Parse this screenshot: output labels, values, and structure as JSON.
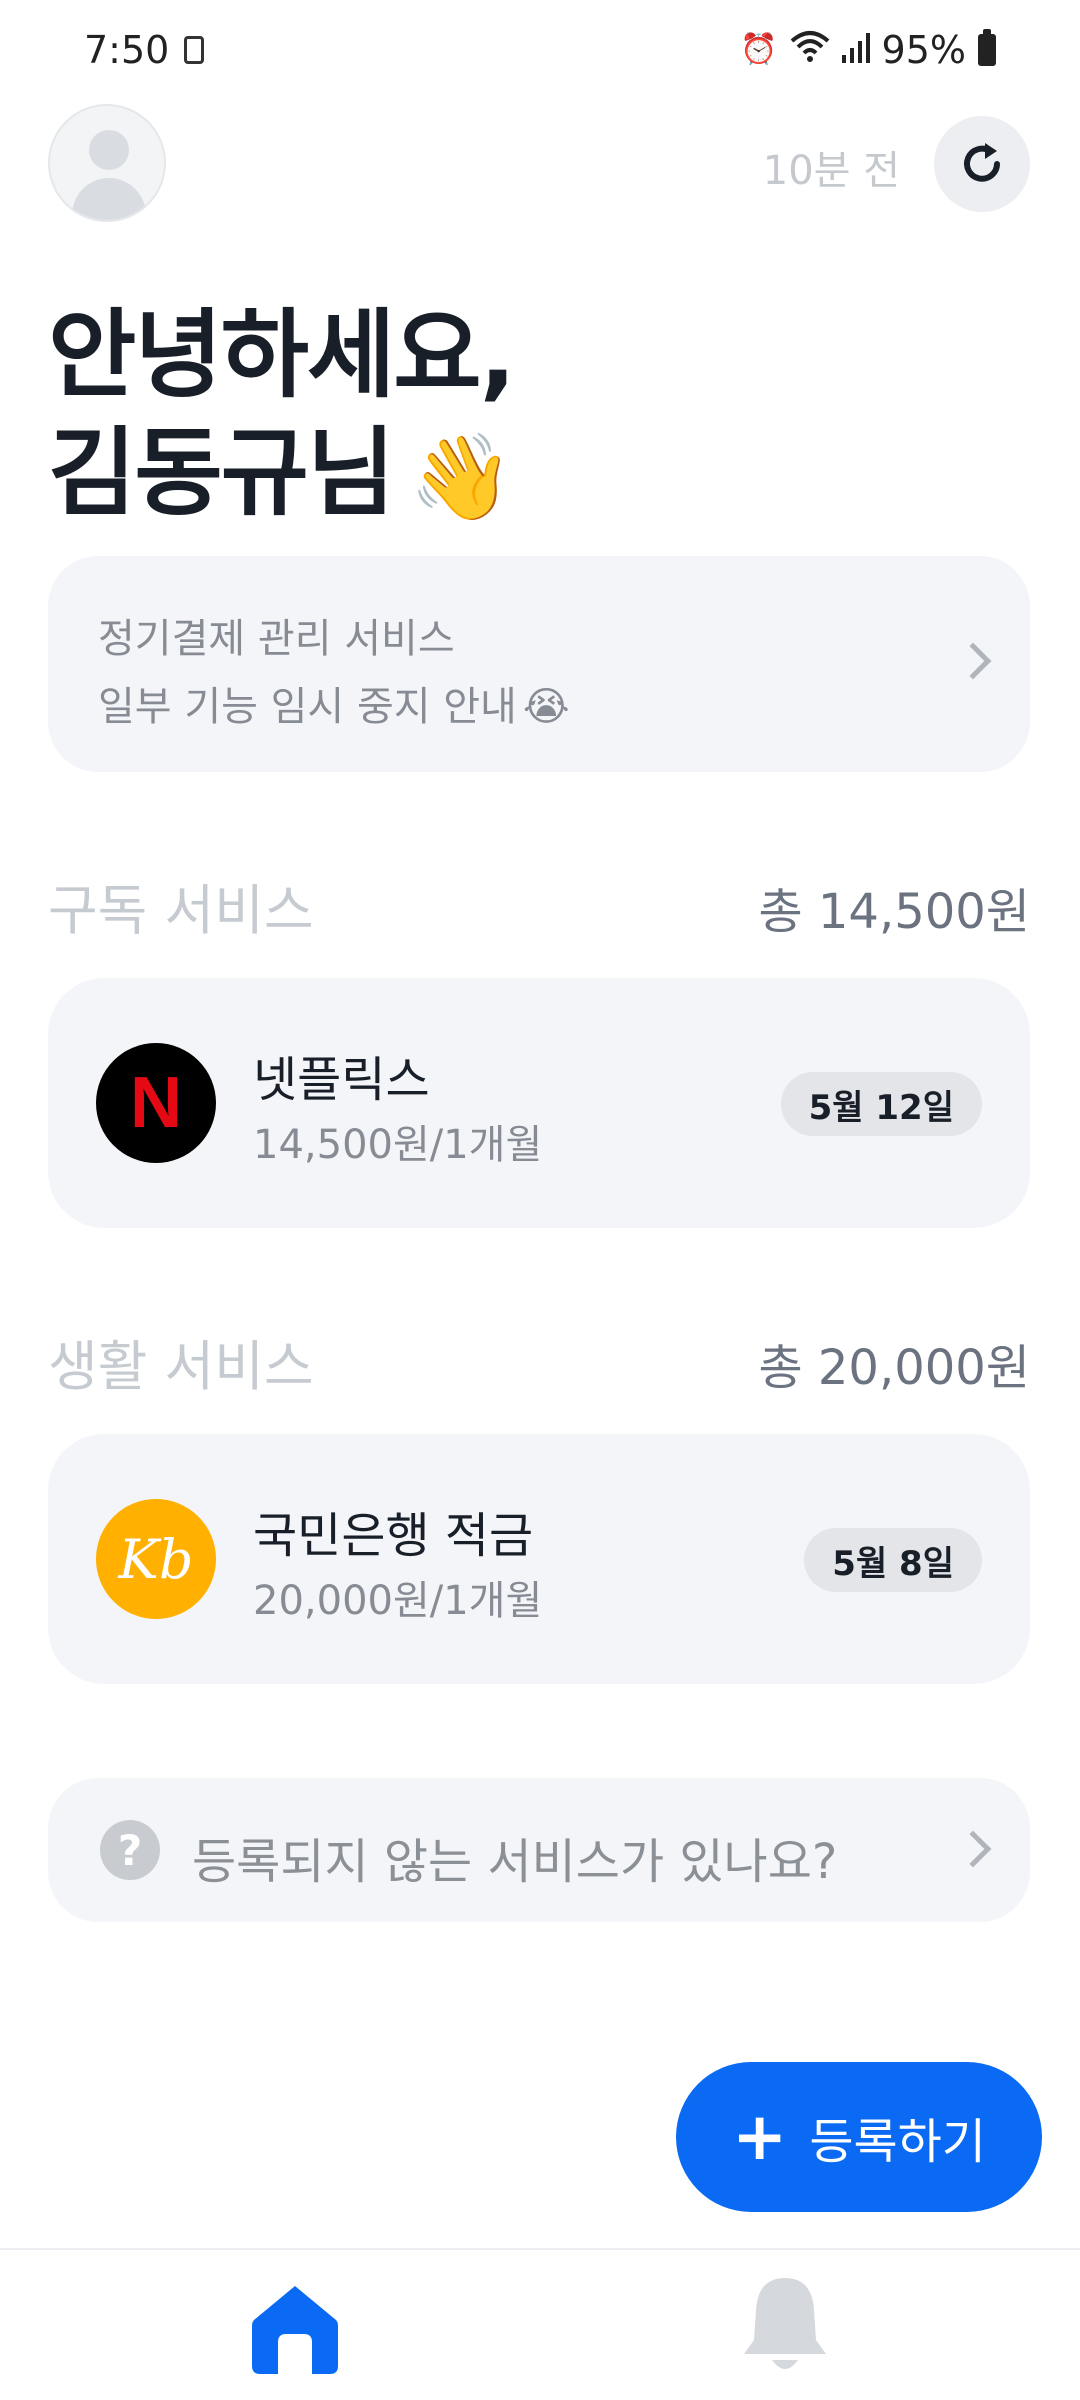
{
  "status_bar": {
    "time": "7:50",
    "battery": "95%",
    "icons": [
      "gallery-icon",
      "alarm-icon",
      "wifi-icon",
      "signal-icon",
      "battery-icon"
    ]
  },
  "header": {
    "updated": "10분 전",
    "refresh_icon": "refresh-icon",
    "avatar_icon": "person-icon"
  },
  "greeting": {
    "line1": "안녕하세요,",
    "line2": "김동규님",
    "emoji": "👋"
  },
  "notice": {
    "line1": "정기결제 관리 서비스",
    "line2": "일부 기능 임시 중지 안내",
    "emoji": "😭"
  },
  "sections": [
    {
      "title": "구독 서비스",
      "total": "총 14,500원",
      "items": [
        {
          "name": "넷플릭스",
          "price": "14,500원/1개월",
          "date": "5월 12일",
          "logo_text": "N",
          "logo_bg": "#000000",
          "logo_color": "#e50914"
        }
      ]
    },
    {
      "title": "생활 서비스",
      "total": "총 20,000원",
      "items": [
        {
          "name": "국민은행 적금",
          "price": "20,000원/1개월",
          "date": "5월 8일",
          "logo_text": "Kb",
          "logo_bg": "#ffb000",
          "logo_color": "#ffffff"
        }
      ]
    }
  ],
  "help": {
    "icon": "?",
    "text": "등록되지 않는 서비스가 있나요?"
  },
  "register": {
    "plus": "+",
    "label": "등록하기"
  },
  "colors": {
    "accent": "#0a6af4",
    "card_bg": "#f4f5f8"
  },
  "nav": {
    "items": [
      "home-icon",
      "bell-icon"
    ]
  }
}
